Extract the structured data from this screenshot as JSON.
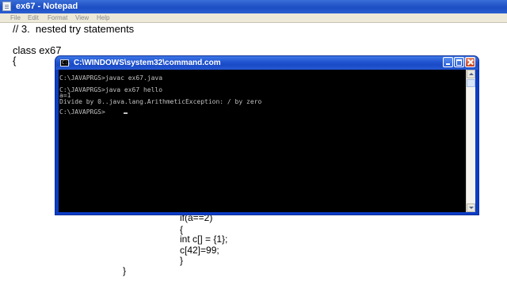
{
  "notepad": {
    "title": "ex67 - Notepad",
    "menu": [
      "File",
      "Edit",
      "Format",
      "View",
      "Help"
    ],
    "code_lines": [
      "// 3.  nested try statements",
      "class ex67",
      "{",
      "if(a==2)",
      "{",
      "int c[] = {1};",
      "c[42]=99;",
      "}",
      "}"
    ]
  },
  "cmd": {
    "title": "C:\\WINDOWS\\system32\\command.com",
    "icon_glyph": "C:\\",
    "lines": [
      "C:\\JAVAPRGS>javac ex67.java",
      "",
      "C:\\JAVAPRGS>java ex67 hello",
      "a=1",
      "Divide by 0..java.lang.ArithmeticException: / by zero",
      "",
      "C:\\JAVAPRGS>"
    ]
  },
  "colors": {
    "titlebar_blue": "#2456c8",
    "console_bg": "#000000",
    "console_text": "#c0c0c0",
    "close_red": "#c8421e"
  },
  "icons": [
    "notepad-icon",
    "cmd-icon",
    "minimize-icon",
    "maximize-icon",
    "close-icon",
    "scroll-up-icon",
    "scroll-down-icon"
  ]
}
